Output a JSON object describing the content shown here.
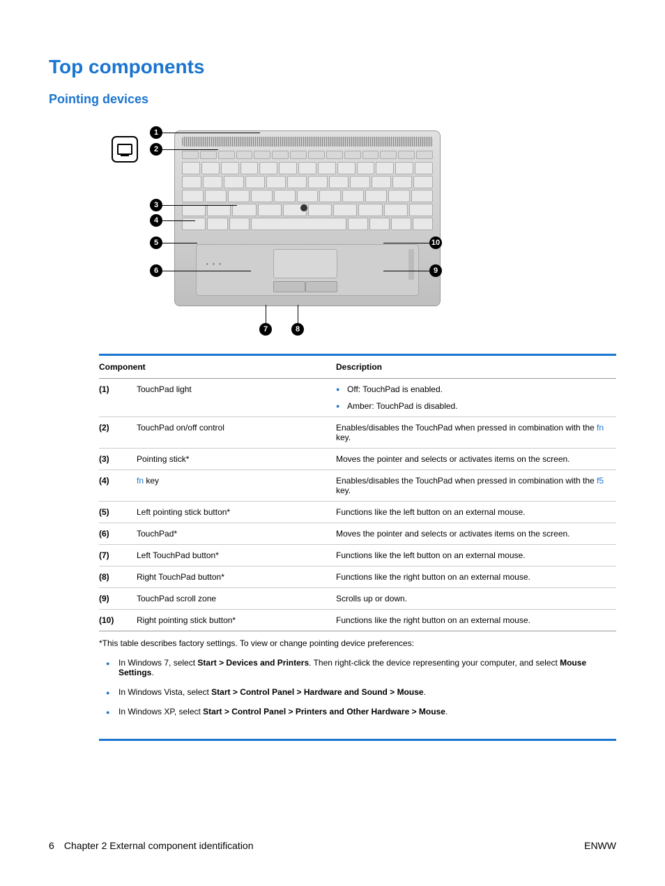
{
  "title": "Top components",
  "subtitle": "Pointing devices",
  "table": {
    "headers": {
      "component": "Component",
      "description": "Description"
    },
    "rows": [
      {
        "num": "(1)",
        "component": "TouchPad light",
        "desc_type": "list",
        "desc_list": [
          "Off: TouchPad is enabled.",
          "Amber: TouchPad is disabled."
        ]
      },
      {
        "num": "(2)",
        "component": "TouchPad on/off control",
        "desc_type": "special1",
        "d_pre": "Enables/disables the TouchPad when pressed in combination with the ",
        "d_key": "fn",
        "d_post": " key."
      },
      {
        "num": "(3)",
        "component": "Pointing stick*",
        "desc": "Moves the pointer and selects or activates items on the screen."
      },
      {
        "num": "(4)",
        "component_special": true,
        "c_key": "fn",
        "c_post": " key",
        "desc_type": "special1",
        "d_pre": "Enables/disables the TouchPad when pressed in combination with the ",
        "d_key": "f5",
        "d_post": " key."
      },
      {
        "num": "(5)",
        "component": "Left pointing stick button*",
        "desc": "Functions like the left button on an external mouse."
      },
      {
        "num": "(6)",
        "component": "TouchPad*",
        "desc": "Moves the pointer and selects or activates items on the screen."
      },
      {
        "num": "(7)",
        "component": "Left TouchPad button*",
        "desc": "Functions like the left button on an external mouse."
      },
      {
        "num": "(8)",
        "component": "Right TouchPad button*",
        "desc": "Functions like the right button on an external mouse."
      },
      {
        "num": "(9)",
        "component": "TouchPad scroll zone",
        "desc": "Scrolls up or down."
      },
      {
        "num": "(10)",
        "component": "Right pointing stick button*",
        "desc": "Functions like the right button on an external mouse."
      }
    ]
  },
  "footnote_intro": "*This table describes factory settings. To view or change pointing device preferences:",
  "footnotes": [
    {
      "pre": "In Windows 7, select ",
      "bold": "Start > Devices and Printers",
      "mid": ". Then right-click the device representing your computer, and select ",
      "bold2": "Mouse Settings",
      "post": "."
    },
    {
      "pre": "In Windows Vista, select ",
      "bold": "Start > Control Panel > Hardware and Sound > Mouse",
      "post": "."
    },
    {
      "pre": "In Windows XP, select ",
      "bold": "Start > Control Panel > Printers and Other Hardware > Mouse",
      "post": "."
    }
  ],
  "footer": {
    "page_num": "6",
    "chapter": "Chapter 2   External component identification",
    "lang": "ENWW"
  },
  "callouts": [
    "1",
    "2",
    "3",
    "4",
    "5",
    "6",
    "7",
    "8",
    "9",
    "10"
  ]
}
